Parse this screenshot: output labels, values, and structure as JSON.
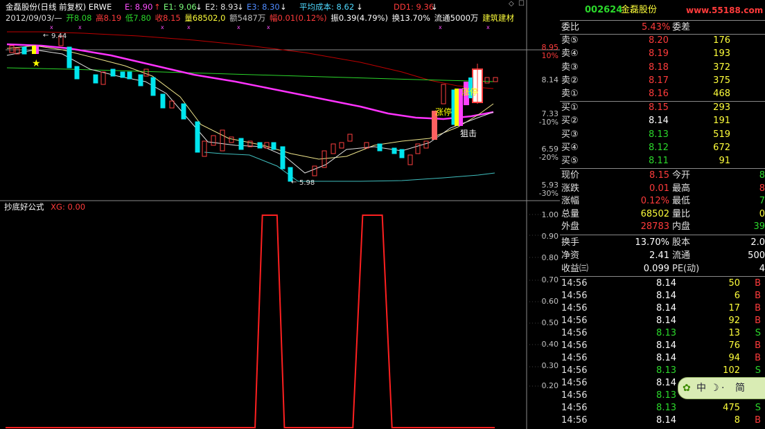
{
  "header": {
    "stock": "金磊股份(日线 前复权) ERWE",
    "e": "E: 8.90",
    "e1": "E1: 9.06",
    "e2": "E2: 8.93",
    "e3": "E3: 8.30",
    "avgcost": "平均成本: 8.62",
    "dd1": "DD1: 9.36",
    "date": "2012/09/03/—",
    "open": "开8.08",
    "high": "高8.19",
    "low": "低7.80",
    "close": "收8.15",
    "volume": "量68502,0",
    "amount": "额5487万",
    "change_pct": "幅0.01(0.12%)",
    "amplitude": "振0.39(4.79%)",
    "turnover": "换13.70%",
    "float": "流通5000万",
    "sector": "建筑建材",
    "ctrl_diamond": "◇",
    "ctrl_menu": "☐"
  },
  "main_chart": {
    "axis": [
      {
        "value": "8.95",
        "pct": "10%"
      },
      {
        "value": "8.14",
        "pct": ""
      },
      {
        "value": "7.33",
        "pct": "-10%"
      },
      {
        "value": "6.59",
        "pct": "-20%"
      },
      {
        "value": "5.93",
        "pct": "-30%"
      }
    ],
    "high_label": "9.44",
    "low_label": "5.98",
    "annot_zhangting1": "涨停",
    "annot_zhangting2": "涨停",
    "annot_zuji": "狙击"
  },
  "chart_data": {
    "type": "line",
    "title": "抄底好公式 XG: 0.00",
    "name": "抄底好公式",
    "xg_label": "XG: 0.00",
    "yticks": [
      "1.00",
      "0.90",
      "0.80",
      "0.70",
      "0.60",
      "0.50",
      "0.40",
      "0.30",
      "0.20"
    ],
    "ylim": [
      0,
      1
    ],
    "signals": [
      {
        "start": 0.51,
        "end": 0.57,
        "value": 1
      },
      {
        "start": 0.71,
        "end": 0.79,
        "value": 1
      }
    ]
  },
  "quote": {
    "code": "002624",
    "name": "金磊股份",
    "watermark": "www.55188.com",
    "weibi_label": "委比",
    "weibi_value": "5.43%",
    "weicha_label": "委差",
    "sell": [
      {
        "label": "卖⑤",
        "price": "8.20",
        "vol": "176"
      },
      {
        "label": "卖④",
        "price": "8.19",
        "vol": "193"
      },
      {
        "label": "卖③",
        "price": "8.18",
        "vol": "372"
      },
      {
        "label": "卖②",
        "price": "8.17",
        "vol": "375"
      },
      {
        "label": "卖①",
        "price": "8.16",
        "vol": "468"
      }
    ],
    "buy": [
      {
        "label": "买①",
        "price": "8.15",
        "vol": "293",
        "pc": "red"
      },
      {
        "label": "买②",
        "price": "8.14",
        "vol": "191",
        "pc": "white"
      },
      {
        "label": "买③",
        "price": "8.13",
        "vol": "519",
        "pc": "green"
      },
      {
        "label": "买④",
        "price": "8.12",
        "vol": "672",
        "pc": "green"
      },
      {
        "label": "买⑤",
        "price": "8.11",
        "vol": "91",
        "pc": "green"
      }
    ],
    "stats": [
      {
        "l1": "现价",
        "v1": "8.15",
        "c1": "red",
        "l2": "今开",
        "v2": "8",
        "c2": "green"
      },
      {
        "l1": "涨跌",
        "v1": "0.01",
        "c1": "red",
        "l2": "最高",
        "v2": "8",
        "c2": "red"
      },
      {
        "l1": "涨幅",
        "v1": "0.12%",
        "c1": "red",
        "l2": "最低",
        "v2": "7",
        "c2": "green"
      },
      {
        "l1": "总量",
        "v1": "68502",
        "c1": "yellow",
        "l2": "量比",
        "v2": "0",
        "c2": "yellow"
      },
      {
        "l1": "外盘",
        "v1": "28783",
        "c1": "red",
        "l2": "内盘",
        "v2": "39",
        "c2": "green"
      }
    ],
    "stats2": [
      {
        "l1": "换手",
        "v1": "13.70%",
        "l2": "股本",
        "v2": "2.0"
      },
      {
        "l1": "净资",
        "v1": "2.41",
        "l2": "流通",
        "v2": "500"
      },
      {
        "l1": "收益㈢",
        "v1": "0.099",
        "l2": "PE(动)",
        "v2": "4"
      }
    ],
    "ticks": [
      {
        "time": "14:56",
        "price": "8.14",
        "pc": "white",
        "vol": "50",
        "side": "B"
      },
      {
        "time": "14:56",
        "price": "8.14",
        "pc": "white",
        "vol": "6",
        "side": "B"
      },
      {
        "time": "14:56",
        "price": "8.14",
        "pc": "white",
        "vol": "17",
        "side": "B"
      },
      {
        "time": "14:56",
        "price": "8.14",
        "pc": "white",
        "vol": "92",
        "side": "B"
      },
      {
        "time": "14:56",
        "price": "8.13",
        "pc": "green",
        "vol": "13",
        "side": "S"
      },
      {
        "time": "14:56",
        "price": "8.14",
        "pc": "white",
        "vol": "76",
        "side": "B"
      },
      {
        "time": "14:56",
        "price": "8.14",
        "pc": "white",
        "vol": "94",
        "side": "B"
      },
      {
        "time": "14:56",
        "price": "8.13",
        "pc": "green",
        "vol": "102",
        "side": "S"
      },
      {
        "time": "14:56",
        "price": "8.14",
        "pc": "white",
        "vol": "",
        "side": ""
      },
      {
        "time": "14:56",
        "price": "8.13",
        "pc": "green",
        "vol": "",
        "side": ""
      },
      {
        "time": "14:56",
        "price": "8.13",
        "pc": "green",
        "vol": "475",
        "side": "S"
      },
      {
        "time": "14:56",
        "price": "8.14",
        "pc": "white",
        "vol": "8",
        "side": "B"
      }
    ],
    "logo_text": "中",
    "logo_text2": "简"
  }
}
